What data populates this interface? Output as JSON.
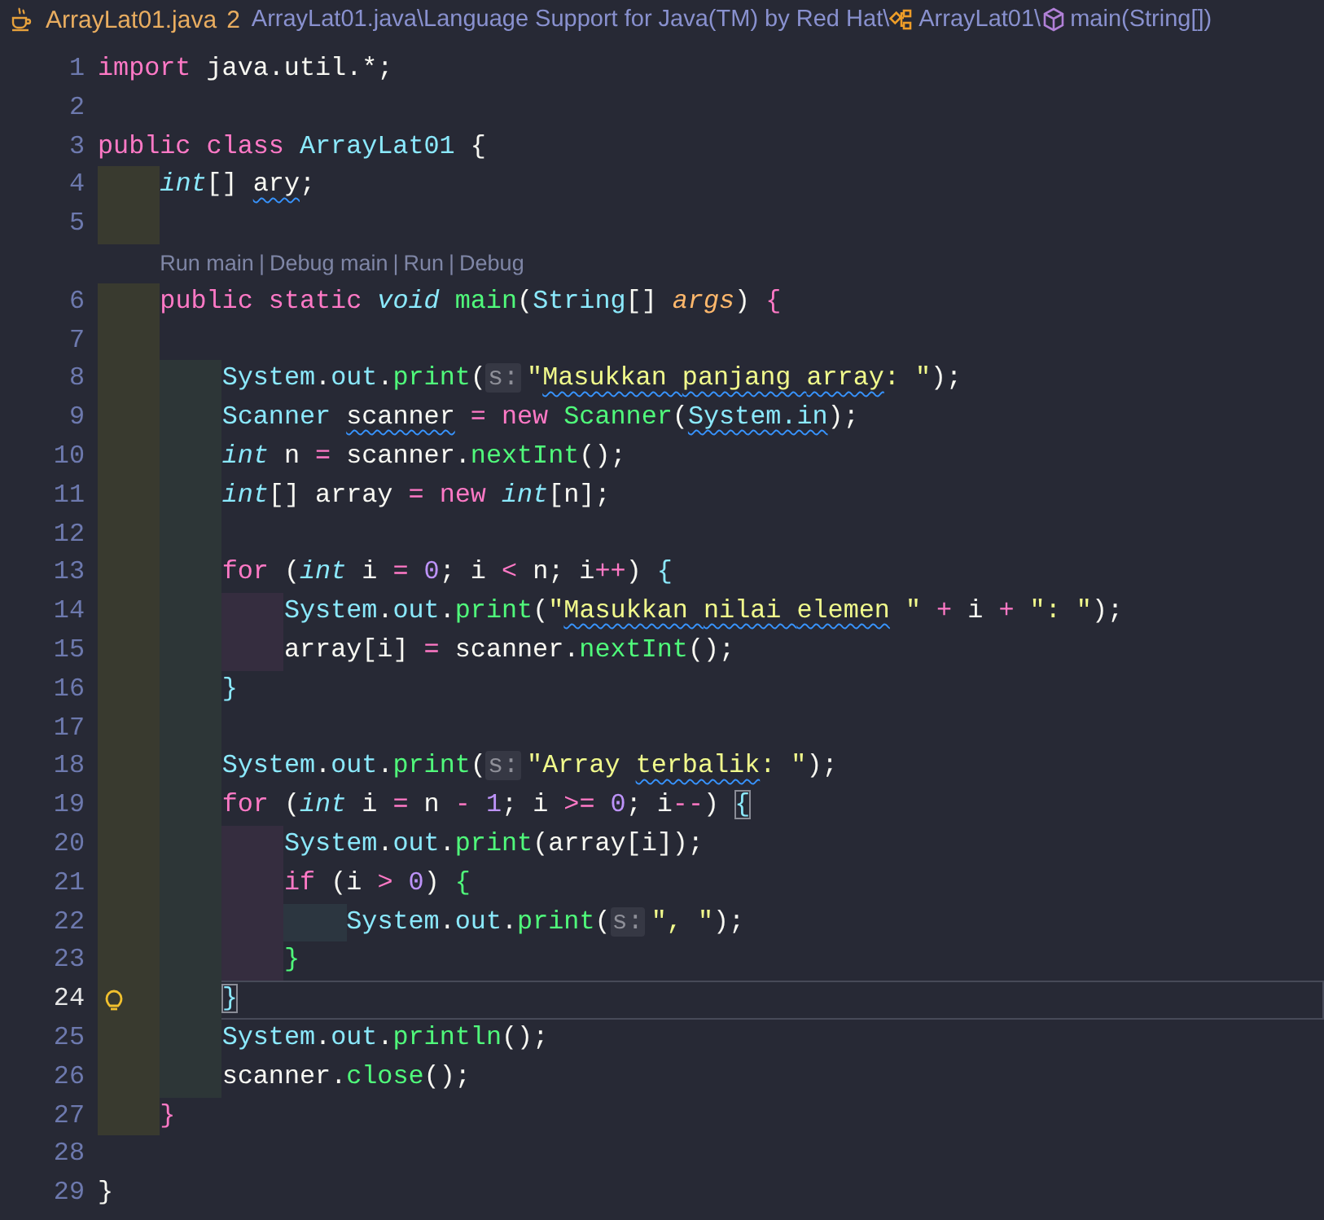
{
  "tab": {
    "filename": "ArrayLat01.java",
    "problems": "2"
  },
  "breadcrumbs": [
    {
      "label": "ArrayLat01.java\\",
      "kind": "file"
    },
    {
      "label": "Language Support for Java(TM) by Red Hat\\",
      "kind": "plain"
    },
    {
      "label": "ArrayLat01\\",
      "kind": "class"
    },
    {
      "label": "main(String[])",
      "kind": "method"
    }
  ],
  "lines": [
    {
      "number": "1",
      "current": false,
      "lightbulb": false,
      "tokens": [
        {
          "text": "import",
          "kind": "kw"
        },
        {
          "text": " java.util.*;",
          "kind": "plain"
        }
      ]
    },
    {
      "number": "2",
      "current": false,
      "lightbulb": false
    },
    {
      "number": "3",
      "current": false,
      "lightbulb": false,
      "tokens": [
        {
          "text": "public class ",
          "kind": "kw"
        },
        {
          "text": "ArrayLat01 ",
          "kind": "cls"
        },
        {
          "text": "{",
          "kind": "br1"
        }
      ]
    },
    {
      "number": "4",
      "current": false,
      "lightbulb": false,
      "tokens": [
        {
          "text": "    int",
          "kind": "type"
        },
        {
          "text": "[] ",
          "kind": "plain"
        },
        {
          "text": "ary",
          "kind": "plain",
          "squiggle": true
        },
        {
          "text": ";",
          "kind": "plain"
        }
      ]
    },
    {
      "number": "5",
      "current": false,
      "lightbulb": false
    },
    {
      "number": "6",
      "current": false,
      "lightbulb": false,
      "codelens": [
        {
          "label": "Run main",
          "kind": "link"
        },
        {
          "label": "|",
          "kind": "separator"
        },
        {
          "label": "Debug main",
          "kind": "link"
        },
        {
          "label": "|",
          "kind": "separator"
        },
        {
          "label": "Run",
          "kind": "link"
        },
        {
          "label": "|",
          "kind": "separator"
        },
        {
          "label": "Debug",
          "kind": "link"
        }
      ],
      "tokens": [
        {
          "text": "    public static ",
          "kind": "kw"
        },
        {
          "text": "void ",
          "kind": "type"
        },
        {
          "text": "main",
          "kind": "fn"
        },
        {
          "text": "(",
          "kind": "plain"
        },
        {
          "text": "String",
          "kind": "cls"
        },
        {
          "text": "[] ",
          "kind": "plain"
        },
        {
          "text": "args",
          "kind": "param"
        },
        {
          "text": ") ",
          "kind": "plain"
        },
        {
          "text": "{",
          "kind": "br2"
        }
      ]
    },
    {
      "number": "7",
      "current": false,
      "lightbulb": false
    },
    {
      "number": "8",
      "current": false,
      "lightbulb": false,
      "tokens": [
        {
          "text": "        System",
          "kind": "cls"
        },
        {
          "text": ".",
          "kind": "plain"
        },
        {
          "text": "out",
          "kind": "cls"
        },
        {
          "text": ".",
          "kind": "plain"
        },
        {
          "text": "print",
          "kind": "fn"
        },
        {
          "text": "(",
          "kind": "plain"
        },
        {
          "text": "s:",
          "kind": "hint"
        },
        {
          "text": "\"",
          "kind": "str"
        },
        {
          "text": "Masukkan ",
          "kind": "str",
          "squiggle": true
        },
        {
          "text": "panjang ",
          "kind": "str",
          "squiggle": true
        },
        {
          "text": "array",
          "kind": "str",
          "squiggle": true
        },
        {
          "text": ": \"",
          "kind": "str"
        },
        {
          "text": ");",
          "kind": "plain"
        }
      ]
    },
    {
      "number": "9",
      "current": false,
      "lightbulb": false,
      "tokens": [
        {
          "text": "        Scanner ",
          "kind": "cls"
        },
        {
          "text": "scanner",
          "kind": "plain",
          "squiggle": true
        },
        {
          "text": " = ",
          "kind": "op"
        },
        {
          "text": "new ",
          "kind": "kw"
        },
        {
          "text": "Scanner",
          "kind": "fn"
        },
        {
          "text": "(",
          "kind": "plain"
        },
        {
          "text": "System.in",
          "kind": "cls",
          "squiggle": true
        },
        {
          "text": ");",
          "kind": "plain"
        }
      ]
    },
    {
      "number": "10",
      "current": false,
      "lightbulb": false,
      "tokens": [
        {
          "text": "        int",
          "kind": "type"
        },
        {
          "text": " n ",
          "kind": "plain"
        },
        {
          "text": "=",
          "kind": "op"
        },
        {
          "text": " scanner.",
          "kind": "plain"
        },
        {
          "text": "nextInt",
          "kind": "fn"
        },
        {
          "text": "();",
          "kind": "plain"
        }
      ]
    },
    {
      "number": "11",
      "current": false,
      "lightbulb": false,
      "tokens": [
        {
          "text": "        int",
          "kind": "type"
        },
        {
          "text": "[] array ",
          "kind": "plain"
        },
        {
          "text": "= ",
          "kind": "op"
        },
        {
          "text": "new ",
          "kind": "kw"
        },
        {
          "text": "int",
          "kind": "type"
        },
        {
          "text": "[n];",
          "kind": "plain"
        }
      ]
    },
    {
      "number": "12",
      "current": false,
      "lightbulb": false
    },
    {
      "number": "13",
      "current": false,
      "lightbulb": false,
      "tokens": [
        {
          "text": "        for",
          "kind": "kw"
        },
        {
          "text": " (",
          "kind": "plain"
        },
        {
          "text": "int",
          "kind": "type"
        },
        {
          "text": " i ",
          "kind": "plain"
        },
        {
          "text": "= ",
          "kind": "op"
        },
        {
          "text": "0",
          "kind": "num"
        },
        {
          "text": "; i ",
          "kind": "plain"
        },
        {
          "text": "< ",
          "kind": "op"
        },
        {
          "text": "n; i",
          "kind": "plain"
        },
        {
          "text": "++",
          "kind": "op"
        },
        {
          "text": ") ",
          "kind": "plain"
        },
        {
          "text": "{",
          "kind": "br3"
        }
      ]
    },
    {
      "number": "14",
      "current": false,
      "lightbulb": false,
      "tokens": [
        {
          "text": "            System",
          "kind": "cls"
        },
        {
          "text": ".",
          "kind": "plain"
        },
        {
          "text": "out",
          "kind": "cls"
        },
        {
          "text": ".",
          "kind": "plain"
        },
        {
          "text": "print",
          "kind": "fn"
        },
        {
          "text": "(",
          "kind": "plain"
        },
        {
          "text": "\"",
          "kind": "str"
        },
        {
          "text": "Masukkan ",
          "kind": "str",
          "squiggle": true
        },
        {
          "text": "nilai ",
          "kind": "str",
          "squiggle": true
        },
        {
          "text": "elemen",
          "kind": "str",
          "squiggle": true
        },
        {
          "text": " \"",
          "kind": "str"
        },
        {
          "text": " + ",
          "kind": "op"
        },
        {
          "text": "i",
          "kind": "plain"
        },
        {
          "text": " + ",
          "kind": "op"
        },
        {
          "text": "\": \"",
          "kind": "str"
        },
        {
          "text": ");",
          "kind": "plain"
        }
      ]
    },
    {
      "number": "15",
      "current": false,
      "lightbulb": false,
      "tokens": [
        {
          "text": "            array[i] ",
          "kind": "plain"
        },
        {
          "text": "= ",
          "kind": "op"
        },
        {
          "text": "scanner.",
          "kind": "plain"
        },
        {
          "text": "nextInt",
          "kind": "fn"
        },
        {
          "text": "();",
          "kind": "plain"
        }
      ]
    },
    {
      "number": "16",
      "current": false,
      "lightbulb": false,
      "tokens": [
        {
          "text": "        }",
          "kind": "br3"
        }
      ]
    },
    {
      "number": "17",
      "current": false,
      "lightbulb": false
    },
    {
      "number": "18",
      "current": false,
      "lightbulb": false,
      "tokens": [
        {
          "text": "        System",
          "kind": "cls"
        },
        {
          "text": ".",
          "kind": "plain"
        },
        {
          "text": "out",
          "kind": "cls"
        },
        {
          "text": ".",
          "kind": "plain"
        },
        {
          "text": "print",
          "kind": "fn"
        },
        {
          "text": "(",
          "kind": "plain"
        },
        {
          "text": "s:",
          "kind": "hint"
        },
        {
          "text": "\"Array ",
          "kind": "str"
        },
        {
          "text": "terbalik",
          "kind": "str",
          "squiggle": true
        },
        {
          "text": ": \"",
          "kind": "str"
        },
        {
          "text": ");",
          "kind": "plain"
        }
      ]
    },
    {
      "number": "19",
      "current": false,
      "lightbulb": false,
      "tokens": [
        {
          "text": "        for",
          "kind": "kw"
        },
        {
          "text": " (",
          "kind": "plain"
        },
        {
          "text": "int",
          "kind": "type"
        },
        {
          "text": " i ",
          "kind": "plain"
        },
        {
          "text": "= ",
          "kind": "op"
        },
        {
          "text": "n ",
          "kind": "plain"
        },
        {
          "text": "- ",
          "kind": "op"
        },
        {
          "text": "1",
          "kind": "num"
        },
        {
          "text": "; i ",
          "kind": "plain"
        },
        {
          "text": ">= ",
          "kind": "op"
        },
        {
          "text": "0",
          "kind": "num"
        },
        {
          "text": "; i",
          "kind": "plain"
        },
        {
          "text": "--",
          "kind": "op"
        },
        {
          "text": ") ",
          "kind": "plain"
        },
        {
          "text": "{",
          "kind": "br3",
          "matched": true
        }
      ]
    },
    {
      "number": "20",
      "current": false,
      "lightbulb": false,
      "tokens": [
        {
          "text": "            System",
          "kind": "cls"
        },
        {
          "text": ".",
          "kind": "plain"
        },
        {
          "text": "out",
          "kind": "cls"
        },
        {
          "text": ".",
          "kind": "plain"
        },
        {
          "text": "print",
          "kind": "fn"
        },
        {
          "text": "(array[i]);",
          "kind": "plain"
        }
      ]
    },
    {
      "number": "21",
      "current": false,
      "lightbulb": false,
      "tokens": [
        {
          "text": "            if",
          "kind": "kw"
        },
        {
          "text": " (i ",
          "kind": "plain"
        },
        {
          "text": "> ",
          "kind": "op"
        },
        {
          "text": "0",
          "kind": "num"
        },
        {
          "text": ") ",
          "kind": "plain"
        },
        {
          "text": "{",
          "kind": "br4"
        }
      ]
    },
    {
      "number": "22",
      "current": false,
      "lightbulb": false,
      "tokens": [
        {
          "text": "                System",
          "kind": "cls"
        },
        {
          "text": ".",
          "kind": "plain"
        },
        {
          "text": "out",
          "kind": "cls"
        },
        {
          "text": ".",
          "kind": "plain"
        },
        {
          "text": "print",
          "kind": "fn"
        },
        {
          "text": "(",
          "kind": "plain"
        },
        {
          "text": "s:",
          "kind": "hint"
        },
        {
          "text": "\", \"",
          "kind": "str"
        },
        {
          "text": ");",
          "kind": "plain"
        }
      ]
    },
    {
      "number": "23",
      "current": false,
      "lightbulb": false,
      "tokens": [
        {
          "text": "            }",
          "kind": "br4"
        }
      ]
    },
    {
      "number": "24",
      "current": true,
      "lightbulb": true,
      "tokens": [
        {
          "text": "        }",
          "kind": "br3",
          "matched": true
        }
      ]
    },
    {
      "number": "25",
      "current": false,
      "lightbulb": false,
      "tokens": [
        {
          "text": "        System",
          "kind": "cls"
        },
        {
          "text": ".",
          "kind": "plain"
        },
        {
          "text": "out",
          "kind": "cls"
        },
        {
          "text": ".",
          "kind": "plain"
        },
        {
          "text": "println",
          "kind": "fn"
        },
        {
          "text": "();",
          "kind": "plain"
        }
      ]
    },
    {
      "number": "26",
      "current": false,
      "lightbulb": false,
      "tokens": [
        {
          "text": "        scanner.",
          "kind": "plain"
        },
        {
          "text": "close",
          "kind": "fn"
        },
        {
          "text": "();",
          "kind": "plain"
        }
      ]
    },
    {
      "number": "27",
      "current": false,
      "lightbulb": false,
      "tokens": [
        {
          "text": "    }",
          "kind": "br2"
        }
      ]
    },
    {
      "number": "28",
      "current": false,
      "lightbulb": false
    },
    {
      "number": "29",
      "current": false,
      "lightbulb": false,
      "tokens": [
        {
          "text": "}",
          "kind": "br1"
        }
      ]
    }
  ]
}
